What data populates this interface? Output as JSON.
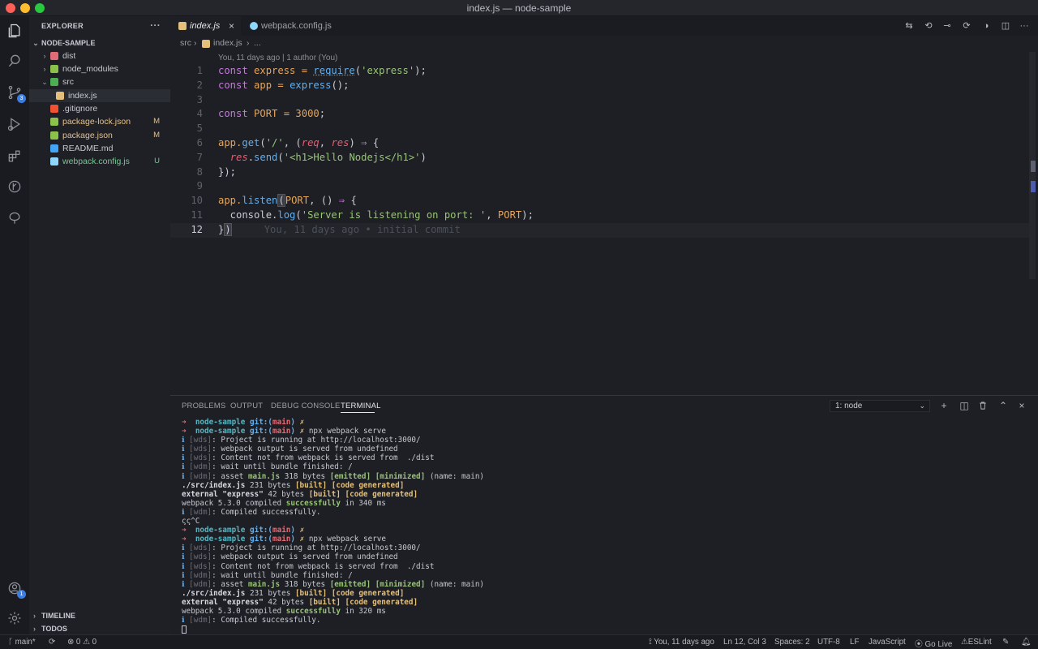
{
  "window": {
    "title": "index.js — node-sample"
  },
  "colors": {
    "close": "#fe5f57",
    "minimize": "#febc2e",
    "maximize": "#28c840",
    "accent": "#3b7de0",
    "modified": "#e2c08d",
    "untracked": "#73c991"
  },
  "activity_bar": {
    "items": [
      {
        "name": "explorer-icon"
      },
      {
        "name": "search-icon"
      },
      {
        "name": "source-control-icon",
        "badge": "3"
      },
      {
        "name": "run-debug-icon"
      },
      {
        "name": "extensions-icon"
      },
      {
        "name": "gitlens-icon"
      },
      {
        "name": "remote-explorer-icon"
      }
    ],
    "bottom": [
      {
        "name": "accounts-icon",
        "badge": "1"
      },
      {
        "name": "settings-gear-icon"
      }
    ]
  },
  "sidebar": {
    "title": "EXPLORER",
    "more": "···",
    "root": "NODE-SAMPLE",
    "items": [
      {
        "label": "dist",
        "type": "folder",
        "chevron": "›",
        "icon_color": "#e06c75",
        "status": ""
      },
      {
        "label": "node_modules",
        "type": "folder",
        "chevron": "›",
        "icon_color": "#8bc34a",
        "status": ""
      },
      {
        "label": "src",
        "type": "folder",
        "chevron": "⌄",
        "icon_color": "#4caf50",
        "status": ""
      },
      {
        "label": "index.js",
        "type": "file",
        "icon_color": "#e5c07b",
        "status": ""
      },
      {
        "label": ".gitignore",
        "type": "file",
        "icon_color": "#f05133",
        "status": ""
      },
      {
        "label": "package-lock.json",
        "type": "file",
        "icon_color": "#8bc34a",
        "status": "M"
      },
      {
        "label": "package.json",
        "type": "file",
        "icon_color": "#8bc34a",
        "status": "M"
      },
      {
        "label": "README.md",
        "type": "file",
        "icon_color": "#42a5f5",
        "status": ""
      },
      {
        "label": "webpack.config.js",
        "type": "file",
        "icon_color": "#8ed6fb",
        "status": "U"
      }
    ],
    "sections": [
      {
        "label": "TIMELINE"
      },
      {
        "label": "TODOS"
      }
    ]
  },
  "tabs": [
    {
      "label": "index.js",
      "active": true,
      "icon_color": "#e5c07b",
      "close": "×"
    },
    {
      "label": "webpack.config.js",
      "active": false,
      "icon_color": "#8ed6fb"
    }
  ],
  "breadcrumb": {
    "folder": "src",
    "sep": "›",
    "file": "index.js",
    "sep2": "›",
    "more": "..."
  },
  "editor": {
    "codelens": "You, 11 days ago | 1 author (You)",
    "line_numbers": [
      "1",
      "2",
      "3",
      "4",
      "5",
      "6",
      "7",
      "8",
      "9",
      "10",
      "11",
      "12"
    ],
    "tokens": {
      "l1": [
        "const",
        " express = ",
        "require",
        "(",
        "'express'",
        ");"
      ],
      "l2": [
        "const",
        " app = ",
        "express",
        "();"
      ],
      "l4": [
        "const",
        " PORT = ",
        "3000",
        ";"
      ],
      "l6": [
        "app.",
        "get",
        "(",
        "'/'",
        ", (",
        "req",
        ", ",
        "res",
        ") ",
        "⇒",
        " {"
      ],
      "l7": [
        "  ",
        "res",
        ".",
        "send",
        "(",
        "'<h1>Hello Nodejs</h1>'",
        ")"
      ],
      "l8": [
        "});"
      ],
      "l10": [
        "app.",
        "listen",
        "(",
        "PORT",
        ", () ",
        "⇒",
        " {"
      ],
      "l11": [
        "  console.",
        "log",
        "(",
        "'Server is listening on port: '",
        ", ",
        "PORT",
        ");"
      ],
      "l12": [
        "}",
        ")"
      ]
    },
    "blame": "You, 11 days ago • initial commit"
  },
  "panel": {
    "tabs": [
      "PROBLEMS",
      "OUTPUT",
      "DEBUG CONSOLE",
      "TERMINAL"
    ],
    "active_tab": "TERMINAL",
    "terminal_select": "1: node",
    "select_chevron": "⌄",
    "actions": [
      {
        "name": "new-terminal-icon",
        "glyph": "+"
      },
      {
        "name": "split-terminal-icon",
        "glyph": "◫"
      },
      {
        "name": "kill-terminal-icon",
        "glyph": "🗑"
      },
      {
        "name": "maximize-panel-icon",
        "glyph": "⌃"
      },
      {
        "name": "close-panel-icon",
        "glyph": "×"
      }
    ]
  },
  "terminal": {
    "arrow": "➜",
    "dir": "node-sample",
    "git": "git:",
    "branch_open": "(",
    "branch": "main",
    "branch_close": ")",
    "x": "✗",
    "info": "ℹ",
    "cmd": "npx webpack serve",
    "wds": "[wds]",
    "wdm": "[wdm]",
    "running": ": Project is running at http://localhost:3000/",
    "served": ": webpack output is served from undefined",
    "content": ": Content not from webpack is served from  ./dist",
    "wait": ": wait until bundle finished: /",
    "asset_pre": ": asset ",
    "asset_file": "main.js",
    "asset_size": " 318 bytes ",
    "emitted": "[emitted]",
    "minimized": "[minimized]",
    "asset_name": " (name: main)",
    "src_file": "./src/index.js",
    "src_size": " 231 bytes ",
    "built": "[built]",
    "code_generated": "[code generated]",
    "ext_file": "external \"express\"",
    "ext_size": " 42 bytes ",
    "compiled_pre": "webpack 5.3.0 compiled ",
    "successfully": "successfully",
    "compiled_1": " in 340 ms",
    "compiled_2": " in 320 ms",
    "compiled_ok": ": Compiled successfully.",
    "interrupt": "ςς^C"
  },
  "statusbar": {
    "branch": "main*",
    "sync": "⟳",
    "problems": "⊗ 0 ⚠ 0",
    "blame": "You, 11 days ago",
    "position": "Ln 12, Col 3",
    "spaces": "Spaces: 2",
    "encoding": "UTF-8",
    "eol": "LF",
    "language": "JavaScript",
    "golive": "Go Live",
    "eslint": "ESLint"
  }
}
